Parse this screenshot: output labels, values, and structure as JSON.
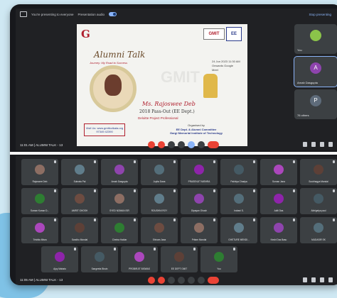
{
  "topbar": {
    "presenting": "You're presenting to everyone",
    "audio": "Presentation audio",
    "stop": "Stop presenting"
  },
  "poster": {
    "title": "Alumni Talk",
    "subtitle": "Journey: My Road to Success",
    "logo_left": "G",
    "logo_right": "GMIT",
    "logo_right2": "EE",
    "date_lines": "24 Jun 2023 11:30 AM Onwards Google Meet",
    "watermark": "GMIT",
    "speaker_name": "Ms. Rajoswee Deb",
    "batch": "2018 Pass-Out (EE Dept.)",
    "role": "Deloitte Project Professional",
    "visit": "Visit Us: www.gmitkolkata.org 97349 42390",
    "org_line1": "Organised by",
    "org_line2": "EE Dept. & Alumni Committee",
    "org_line3": "Gargi Memorial Institute of Technology"
  },
  "side": [
    {
      "name": "You",
      "initial": "",
      "color": "#8bc34a"
    },
    {
      "name": "Arnab Dasgupta",
      "initial": "A",
      "color": "#8e44ad"
    },
    {
      "name": "76 others",
      "initial": "P",
      "color": "#5e6b7a"
    }
  ],
  "meeting1": "11:01 AM | ALUMNI TALK - 13",
  "meeting2": "11:05 AM | ALUMNI TALK - 13",
  "participants": [
    "Rajoswee Deb",
    "Subrata Pal",
    "Arnab Dasgupta",
    "Joyita Dana",
    "PRASENJIT MISHRA",
    "Pakhiya Chadya",
    "Suman Jana",
    "Soubhagya Mandal",
    "Suman Kumar D...",
    "AMRIT GHOSH",
    "SYED NOMAN ISR",
    "ROUSHNI ROY",
    "Dipayan Ghosh",
    "Indrani S.",
    "Aditi Das",
    "Abhigetya paul",
    "Trishita Misra",
    "Sandhu Mondal",
    "Chetna Haldar",
    "Shivam Jana",
    "Pritam Mondal",
    "GHETURE MENDI...",
    "Keshi Das Basu",
    "MUDASIR SK",
    "Ajoy Mahato",
    "Sangeeta Bhuin",
    "PROBIRJIT BISWAS",
    "EE DEPT GMIT",
    "You"
  ]
}
